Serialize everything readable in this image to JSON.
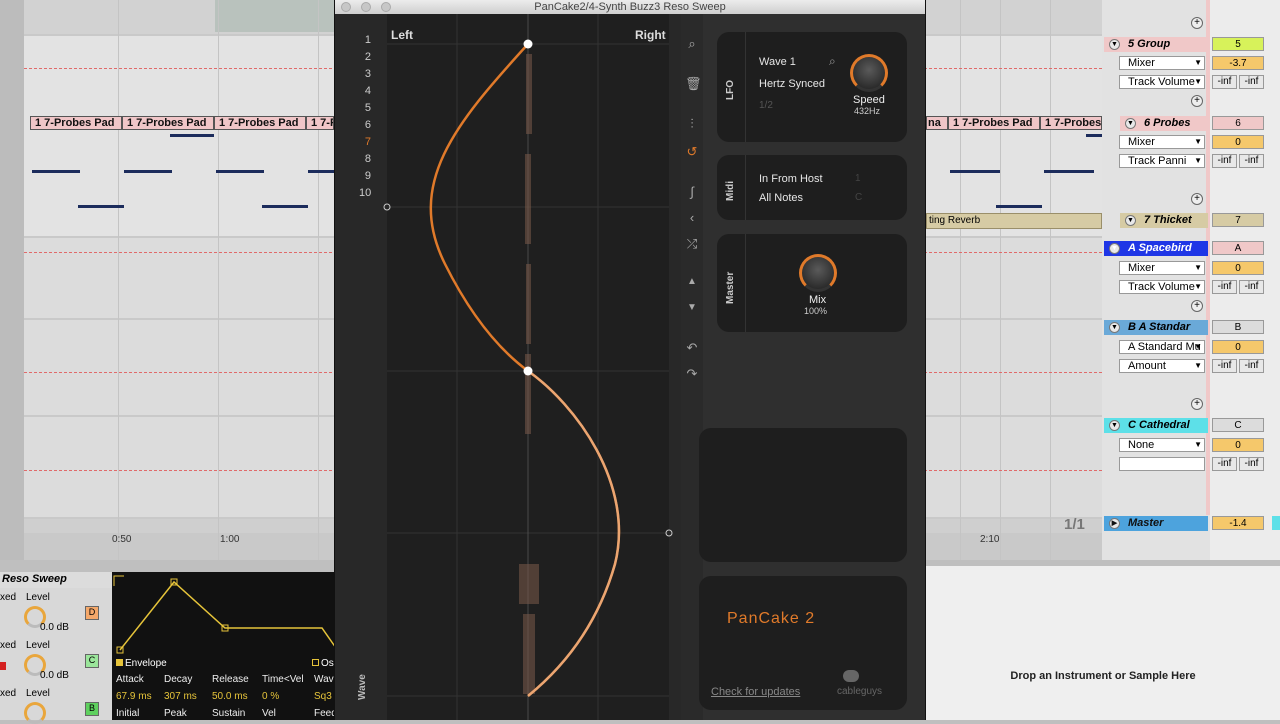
{
  "plugin": {
    "title": "PanCake2/4-Synth Buzz3 Reso Sweep",
    "left_label": "Left",
    "right_label": "Right",
    "row_numbers": [
      "1",
      "2",
      "3",
      "4",
      "5",
      "6",
      "7",
      "8",
      "9",
      "10"
    ],
    "wave_label": "Wave",
    "lfo": {
      "label": "LFO",
      "wave": "Wave 1",
      "mode": "Hertz Synced",
      "ratio": "1/2",
      "knob_label": "Speed",
      "knob_value": "432Hz"
    },
    "midi": {
      "label": "Midi",
      "source": "In From Host",
      "notes": "All Notes",
      "source_num": "1",
      "notes_num": "C"
    },
    "master": {
      "label": "Master",
      "knob_label": "Mix",
      "knob_value": "100%"
    },
    "brand": "PanCake 2",
    "update_link": "Check for updates",
    "company": "cableguys"
  },
  "arrangement": {
    "clips": [
      "1 7-Probes Pad",
      "1 7-Probes Pad",
      "1 7-Probes Pad",
      "1 7-Pr",
      "1 7-Probes Pad",
      "1 7-Probes Pad",
      "1 7-Probes"
    ],
    "reverb_clip": "ting Reverb",
    "ruler": [
      "0:50",
      "1:00",
      "2:10"
    ],
    "page": "1/1"
  },
  "tracks": [
    {
      "name": "5 Group",
      "dd1": "Mixer",
      "dd2": "Track Volume",
      "val1": "5",
      "val2": "-3.7",
      "inf1": "-inf",
      "inf2": "-inf"
    },
    {
      "name": "6 Probes",
      "dd1": "Mixer",
      "dd2": "Track Panni",
      "val1": "6",
      "val2": "0",
      "inf1": "-inf",
      "inf2": "-inf"
    },
    {
      "name": "7 Thicket",
      "val1": "7"
    },
    {
      "name": "A Spacebird",
      "dd1": "Mixer",
      "dd2": "Track Volume",
      "val1": "A",
      "val2": "0",
      "inf1": "-inf",
      "inf2": "-inf"
    },
    {
      "name": "B A Standar",
      "dd1": "A Standard Mu",
      "dd2": "Amount",
      "val1": "B",
      "val2": "0",
      "inf1": "-inf",
      "inf2": "-inf"
    },
    {
      "name": "C Cathedral",
      "dd1": "None",
      "dd2": "",
      "val1": "C",
      "val2": "0",
      "inf1": "-inf",
      "inf2": "-inf"
    },
    {
      "name": "Master",
      "val1": "-1.4"
    }
  ],
  "device": {
    "title": "Reso Sweep",
    "rows": [
      {
        "prefix": "xed",
        "label": "Level",
        "value": "0.0 dB",
        "tag": "D"
      },
      {
        "prefix": "xed",
        "label": "Level",
        "value": "0.0 dB",
        "tag": "C"
      },
      {
        "prefix": "xed",
        "label": "Level",
        "value": "0.0 dB",
        "tag": "B"
      }
    ],
    "envelope_label": "Envelope",
    "osc_label": "Os",
    "params": [
      "Attack",
      "Decay",
      "Release",
      "Time<Vel",
      "Wav"
    ],
    "values": [
      "67.9 ms",
      "307 ms",
      "50.0 ms",
      "0 %",
      "Sq3"
    ],
    "params2": [
      "Initial",
      "Peak",
      "Sustain",
      "Vel",
      "Feed"
    ]
  },
  "drop_text": "Drop an Instrument or Sample Here"
}
